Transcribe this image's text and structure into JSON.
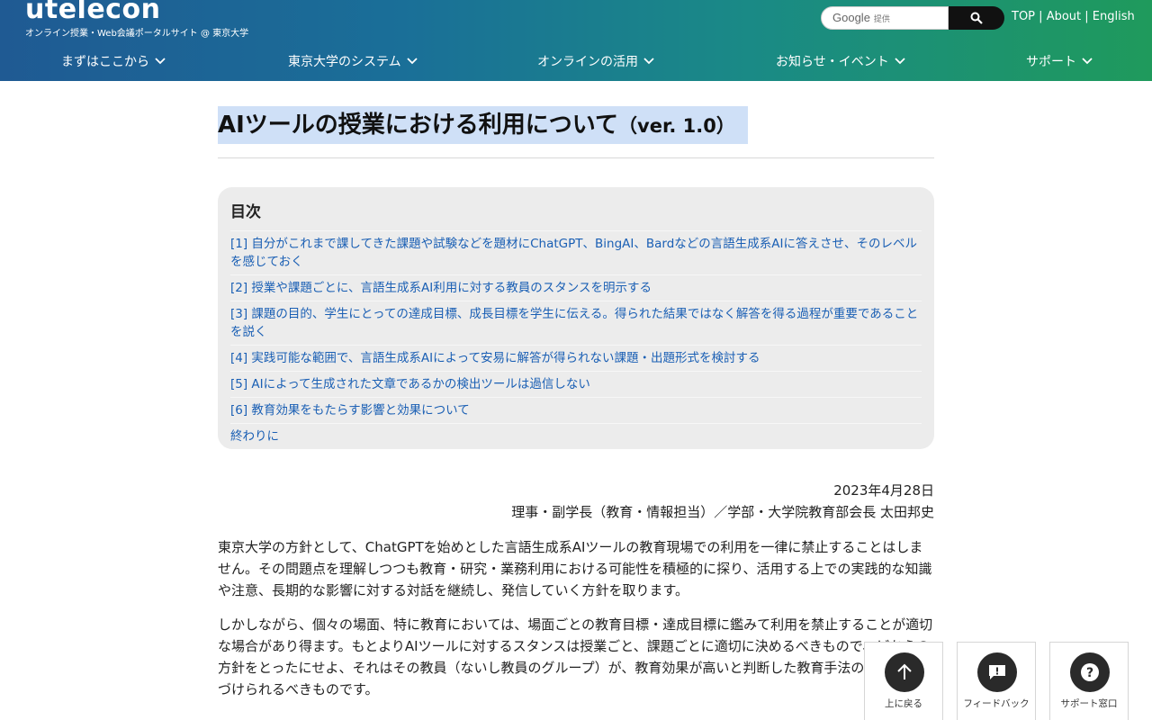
{
  "header": {
    "site_name": "utelecon",
    "tagline": "オンライン授業・Web会議ポータルサイト @ 東京大学",
    "search_logo": "Google",
    "search_provider": "提供",
    "top_links": [
      "TOP",
      "About",
      "English"
    ],
    "separator": "|",
    "nav": [
      "まずはここから",
      "東京大学のシステム",
      "オンラインの活用",
      "お知らせ・イベント",
      "サポート"
    ]
  },
  "article": {
    "title_main": "AIツールの授業における利用について",
    "title_ver": "（ver. 1.0）",
    "toc_heading": "目次",
    "toc": [
      "[1] 自分がこれまで課してきた課題や試験などを題材にChatGPT、BingAI、Bardなどの言語生成系AIに答えさせ、そのレベルを感じておく",
      "[2] 授業や課題ごとに、言語生成系AI利用に対する教員のスタンスを明示する",
      "[3] 課題の目的、学生にとっての達成目標、成長目標を学生に伝える。得られた結果ではなく解答を得る過程が重要であることを説く",
      "[4] 実践可能な範囲で、言語生成系AIによって安易に解答が得られない課題・出題形式を検討する",
      "[5] AIによって生成された文章であるかの検出ツールは過信しない",
      "[6] 教育効果をもたらす影響と効果について",
      "終わりに"
    ],
    "date": "2023年4月28日",
    "author": "理事・副学長（教育・情報担当）／学部・大学院教育部会長 太田邦史",
    "para1": "東京大学の方針として、ChatGPTを始めとした言語生成系AIツールの教育現場での利用を一律に禁止することはしません。その問題点を理解しつつも教育・研究・業務利用における可能性を積極的に探り、活用する上での実践的な知識や注意、長期的な影響に対する対話を継続し、発信していく方針を取ります。",
    "para2": "しかしながら、個々の場面、特に教育においては、場面ごとの教育目標・達成目標に鑑みて利用を禁止することが適切な場合があり得ます。もとよりAIツールに対するスタンスは授業ごと、課題ごとに適切に決めるべきもので、どちらの方針をとったにせよ、それはその教員（ないし教員のグループ）が、教育効果が高いと判断した教育手法の一部と位置づけられるべきものです。"
  },
  "floating": {
    "back_top": "上に戻る",
    "feedback": "フィードバック",
    "support": "サポート窓口"
  }
}
